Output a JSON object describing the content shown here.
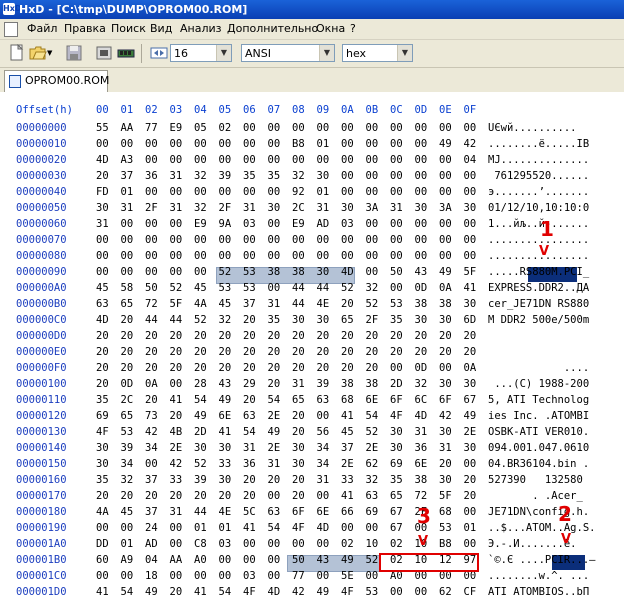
{
  "window": {
    "title": "HxD - [C:\\tmp\\DUMP\\OPROM00.ROM]",
    "app_icon": "HxD"
  },
  "menu": [
    "Файл",
    "Правка",
    "Поиск",
    "Вид",
    "Анализ",
    "Дополнительно",
    "Окна",
    "?"
  ],
  "toolbar": {
    "bytes_per_row": "16",
    "charset": "ANSI",
    "offset_base": "hex"
  },
  "tab": {
    "label": "OPROM00.ROM"
  },
  "header": {
    "offset_label": "Offset(h)",
    "columns": [
      "00",
      "01",
      "02",
      "03",
      "04",
      "05",
      "06",
      "07",
      "08",
      "09",
      "0A",
      "0B",
      "0C",
      "0D",
      "0E",
      "0F"
    ]
  },
  "rows": [
    {
      "offset": "00000000",
      "bytes": [
        "55",
        "AA",
        "77",
        "E9",
        "05",
        "02",
        "00",
        "00",
        "00",
        "00",
        "00",
        "00",
        "00",
        "00",
        "00",
        "00"
      ],
      "ascii": "UЄwй.........."
    },
    {
      "offset": "00000010",
      "bytes": [
        "00",
        "00",
        "00",
        "00",
        "00",
        "00",
        "00",
        "00",
        "B8",
        "01",
        "00",
        "00",
        "00",
        "00",
        "49",
        "42"
      ],
      "ascii": "........ё.....IB"
    },
    {
      "offset": "00000020",
      "bytes": [
        "4D",
        "A3",
        "00",
        "00",
        "00",
        "00",
        "00",
        "00",
        "00",
        "00",
        "00",
        "00",
        "00",
        "00",
        "00",
        "04"
      ],
      "ascii": "MЈ.............."
    },
    {
      "offset": "00000030",
      "bytes": [
        "20",
        "37",
        "36",
        "31",
        "32",
        "39",
        "35",
        "35",
        "32",
        "30",
        "00",
        "00",
        "00",
        "00",
        "00",
        "00"
      ],
      "ascii": " 761295520......"
    },
    {
      "offset": "00000040",
      "bytes": [
        "FD",
        "01",
        "00",
        "00",
        "00",
        "00",
        "00",
        "00",
        "92",
        "01",
        "00",
        "00",
        "00",
        "00",
        "00",
        "00"
      ],
      "ascii": "э.......’......."
    },
    {
      "offset": "00000050",
      "bytes": [
        "30",
        "31",
        "2F",
        "31",
        "32",
        "2F",
        "31",
        "30",
        "2C",
        "31",
        "30",
        "3A",
        "31",
        "30",
        "3A",
        "30"
      ],
      "ascii": "01/12/10,10:10:0"
    },
    {
      "offset": "00000060",
      "bytes": [
        "31",
        "00",
        "00",
        "00",
        "E9",
        "9A",
        "03",
        "00",
        "E9",
        "AD",
        "03",
        "00",
        "00",
        "00",
        "00",
        "00"
      ],
      "ascii": "1...йљ..й-......"
    },
    {
      "offset": "00000070",
      "bytes": [
        "00",
        "00",
        "00",
        "00",
        "00",
        "00",
        "00",
        "00",
        "00",
        "00",
        "00",
        "00",
        "00",
        "00",
        "00",
        "00"
      ],
      "ascii": "................"
    },
    {
      "offset": "00000080",
      "bytes": [
        "00",
        "00",
        "00",
        "00",
        "00",
        "00",
        "00",
        "00",
        "00",
        "00",
        "00",
        "00",
        "00",
        "00",
        "00",
        "00"
      ],
      "ascii": "................"
    },
    {
      "offset": "00000090",
      "bytes": [
        "00",
        "00",
        "00",
        "00",
        "00",
        "52",
        "53",
        "38",
        "38",
        "30",
        "4D",
        "00",
        "50",
        "43",
        "49",
        "5F"
      ],
      "ascii": ".....RS880M.PCI_"
    },
    {
      "offset": "000000A0",
      "bytes": [
        "45",
        "58",
        "50",
        "52",
        "45",
        "53",
        "53",
        "00",
        "44",
        "44",
        "52",
        "32",
        "00",
        "0D",
        "0A",
        "41"
      ],
      "ascii": "EXPRESS.DDR2..ДA"
    },
    {
      "offset": "000000B0",
      "bytes": [
        "63",
        "65",
        "72",
        "5F",
        "4A",
        "45",
        "37",
        "31",
        "44",
        "4E",
        "20",
        "52",
        "53",
        "38",
        "38",
        "30"
      ],
      "ascii": "cer_JE71DN RS880"
    },
    {
      "offset": "000000C0",
      "bytes": [
        "4D",
        "20",
        "44",
        "44",
        "52",
        "32",
        "20",
        "35",
        "30",
        "30",
        "65",
        "2F",
        "35",
        "30",
        "30",
        "6D"
      ],
      "ascii": "M DDR2 500e/500m"
    },
    {
      "offset": "000000D0",
      "bytes": [
        "20",
        "20",
        "20",
        "20",
        "20",
        "20",
        "20",
        "20",
        "20",
        "20",
        "20",
        "20",
        "20",
        "20",
        "20",
        "20"
      ],
      "ascii": "                "
    },
    {
      "offset": "000000E0",
      "bytes": [
        "20",
        "20",
        "20",
        "20",
        "20",
        "20",
        "20",
        "20",
        "20",
        "20",
        "20",
        "20",
        "20",
        "20",
        "20",
        "20"
      ],
      "ascii": "                "
    },
    {
      "offset": "000000F0",
      "bytes": [
        "20",
        "20",
        "20",
        "20",
        "20",
        "20",
        "20",
        "20",
        "20",
        "20",
        "20",
        "20",
        "00",
        "0D",
        "00",
        "0A"
      ],
      "ascii": "            ...."
    },
    {
      "offset": "00000100",
      "bytes": [
        "20",
        "0D",
        "0A",
        "00",
        "28",
        "43",
        "29",
        "20",
        "31",
        "39",
        "38",
        "38",
        "2D",
        "32",
        "30",
        "30"
      ],
      "ascii": " ...(C) 1988-200"
    },
    {
      "offset": "00000110",
      "bytes": [
        "35",
        "2C",
        "20",
        "41",
        "54",
        "49",
        "20",
        "54",
        "65",
        "63",
        "68",
        "6E",
        "6F",
        "6C",
        "6F",
        "67"
      ],
      "ascii": "5, ATI Technolog"
    },
    {
      "offset": "00000120",
      "bytes": [
        "69",
        "65",
        "73",
        "20",
        "49",
        "6E",
        "63",
        "2E",
        "20",
        "00",
        "41",
        "54",
        "4F",
        "4D",
        "42",
        "49"
      ],
      "ascii": "ies Inc. .ATOMBI"
    },
    {
      "offset": "00000130",
      "bytes": [
        "4F",
        "53",
        "42",
        "4B",
        "2D",
        "41",
        "54",
        "49",
        "20",
        "56",
        "45",
        "52",
        "30",
        "31",
        "30",
        "2E"
      ],
      "ascii": "OSBK-ATI VER010."
    },
    {
      "offset": "00000140",
      "bytes": [
        "30",
        "39",
        "34",
        "2E",
        "30",
        "30",
        "31",
        "2E",
        "30",
        "34",
        "37",
        "2E",
        "30",
        "36",
        "31",
        "30"
      ],
      "ascii": "094.001.047.0610"
    },
    {
      "offset": "00000150",
      "bytes": [
        "30",
        "34",
        "00",
        "42",
        "52",
        "33",
        "36",
        "31",
        "30",
        "34",
        "2E",
        "62",
        "69",
        "6E",
        "20",
        "00"
      ],
      "ascii": "04.BR36104.bin ."
    },
    {
      "offset": "00000160",
      "bytes": [
        "35",
        "32",
        "37",
        "33",
        "39",
        "30",
        "20",
        "20",
        "20",
        "31",
        "33",
        "32",
        "35",
        "38",
        "30",
        "20"
      ],
      "ascii": "527390   132580 "
    },
    {
      "offset": "00000170",
      "bytes": [
        "20",
        "20",
        "20",
        "20",
        "20",
        "20",
        "20",
        "00",
        "20",
        "00",
        "41",
        "63",
        "65",
        "72",
        "5F",
        "20"
      ],
      "ascii": "       . .Acer_ "
    },
    {
      "offset": "00000180",
      "bytes": [
        "4A",
        "45",
        "37",
        "31",
        "44",
        "4E",
        "5C",
        "63",
        "6F",
        "6E",
        "66",
        "69",
        "67",
        "2E",
        "68",
        "00"
      ],
      "ascii": "JE71DN\\config.h."
    },
    {
      "offset": "00000190",
      "bytes": [
        "00",
        "00",
        "24",
        "00",
        "01",
        "01",
        "41",
        "54",
        "4F",
        "4D",
        "00",
        "00",
        "67",
        "00",
        "53",
        "01"
      ],
      "ascii": "..$...ATOM..Ag.S."
    },
    {
      "offset": "000001A0",
      "bytes": [
        "DD",
        "01",
        "AD",
        "00",
        "C8",
        "03",
        "00",
        "00",
        "00",
        "00",
        "02",
        "10",
        "02",
        "10",
        "B8",
        "00"
      ],
      "ascii": "Э.-.И.......ё."
    },
    {
      "offset": "000001B0",
      "bytes": [
        "60",
        "A9",
        "04",
        "AA",
        "A0",
        "00",
        "00",
        "00",
        "50",
        "43",
        "49",
        "52",
        "02",
        "10",
        "12",
        "97"
      ],
      "ascii": "`©.Є ....PCIR...—"
    },
    {
      "offset": "000001C0",
      "bytes": [
        "00",
        "00",
        "18",
        "00",
        "00",
        "00",
        "03",
        "00",
        "77",
        "00",
        "5E",
        "00",
        "A0",
        "00",
        "00",
        "00"
      ],
      "ascii": "........w.^. ..."
    },
    {
      "offset": "000001D0",
      "bytes": [
        "41",
        "54",
        "49",
        "20",
        "41",
        "54",
        "4F",
        "4D",
        "42",
        "49",
        "4F",
        "53",
        "00",
        "00",
        "62",
        "CF"
      ],
      "ascii": "ATI ATOMBIOS..bП"
    }
  ],
  "annotations": [
    "1",
    "2",
    "3"
  ]
}
